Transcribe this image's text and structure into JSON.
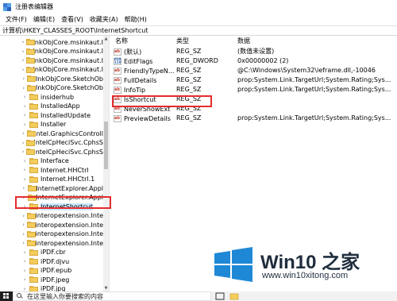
{
  "window": {
    "title": "注册表编辑器"
  },
  "menu": [
    "文件(F)",
    "编辑(E)",
    "查看(V)",
    "收藏夹(A)",
    "帮助(H)"
  ],
  "address": "计算机\\HKEY_CLASSES_ROOT\\InternetShortcut",
  "tree": {
    "items": [
      {
        "label": "InkObjCore.msinkaut.I",
        "expandable": true
      },
      {
        "label": "InkObjCore.msinkaut.I",
        "expandable": true
      },
      {
        "label": "InkObjCore.msinkaut.I",
        "expandable": true
      },
      {
        "label": "InkObjCore.msinkaut.I",
        "expandable": true
      },
      {
        "label": "InkObjCore.SketchOb",
        "expandable": true
      },
      {
        "label": "InkObjCore.SketchOb",
        "expandable": true
      },
      {
        "label": "insiderhub",
        "expandable": true
      },
      {
        "label": "InstalledApp",
        "expandable": true
      },
      {
        "label": "InstalledUpdate",
        "expandable": true
      },
      {
        "label": "Installer",
        "expandable": true
      },
      {
        "label": "Intel.GraphicsControll",
        "expandable": true
      },
      {
        "label": "IntelCpHeciSvc.CphsS",
        "expandable": true
      },
      {
        "label": "IntelCpHeciSvc.CphsS",
        "expandable": true
      },
      {
        "label": "Interface",
        "expandable": true
      },
      {
        "label": "Internet.HHCtrl",
        "expandable": true
      },
      {
        "label": "Internet.HHCtrl.1",
        "expandable": true
      },
      {
        "label": "InternetExplorer.Appl",
        "expandable": true
      },
      {
        "label": "InternetExplorer.Appl",
        "expandable": true
      },
      {
        "label": "InternetShortcut",
        "expandable": true,
        "selected": true
      },
      {
        "label": "interopextension.Inte",
        "expandable": true
      },
      {
        "label": "interopextension.Inte",
        "expandable": true
      },
      {
        "label": "interopextension.Inte",
        "expandable": true
      },
      {
        "label": "interopextension.Inte",
        "expandable": true
      },
      {
        "label": "iPDF.cbr",
        "expandable": true
      },
      {
        "label": "iPDF.djvu",
        "expandable": true
      },
      {
        "label": "iPDF.epub",
        "expandable": true
      },
      {
        "label": "iPDF.jpeg",
        "expandable": true
      },
      {
        "label": "iPDF.jpg",
        "expandable": true
      }
    ]
  },
  "list": {
    "headers": {
      "name": "名称",
      "type": "类型",
      "data": "数据"
    },
    "rows": [
      {
        "name": "(默认)",
        "type": "REG_SZ",
        "data": "(数值未设置)",
        "icon": "string-value-icon"
      },
      {
        "name": "EditFlags",
        "type": "REG_DWORD",
        "data": "0x00000002 (2)",
        "icon": "binary-value-icon"
      },
      {
        "name": "FriendlyTypeN...",
        "type": "REG_SZ",
        "data": "@C:\\Windows\\System32\\ieframe.dll,-10046",
        "icon": "string-value-icon"
      },
      {
        "name": "FullDetails",
        "type": "REG_SZ",
        "data": "prop:System.Link.TargetUrl;System.Rating;Sys...",
        "icon": "string-value-icon"
      },
      {
        "name": "InfoTip",
        "type": "REG_SZ",
        "data": "prop:System.Link.TargetUrl;System.Rating;Sys...",
        "icon": "string-value-icon"
      },
      {
        "name": "IsShortcut",
        "type": "REG_SZ",
        "data": "",
        "icon": "string-value-icon",
        "highlighted": true
      },
      {
        "name": "NeverShowExt",
        "type": "REG_SZ",
        "data": "",
        "icon": "string-value-icon"
      },
      {
        "name": "PreviewDetails",
        "type": "REG_SZ",
        "data": "prop:System.Link.TargetUrl;System.Rating;Sys...",
        "icon": "string-value-icon"
      }
    ]
  },
  "taskbar": {
    "search_placeholder": "在这里输入你要搜索的内容"
  },
  "watermark": {
    "title": "Win10 之家",
    "url": "www.win10xitong.com"
  },
  "colors": {
    "highlight_border": "#e52c2c",
    "selection": "#cce8ff",
    "folder": "#f3cd5c",
    "watermark_blue": "#1e88d6"
  }
}
